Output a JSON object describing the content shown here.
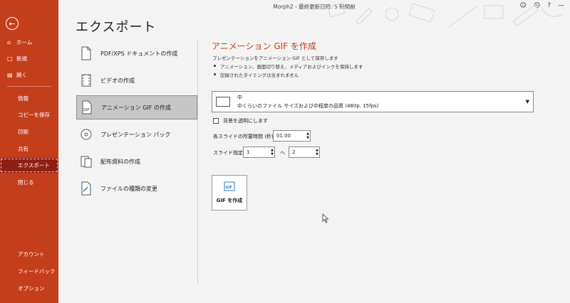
{
  "titlebar": {
    "title": "Morph2 - 最終更新日時: 5 時間前",
    "icons": [
      "smiley-icon",
      "sad-icon",
      "help-icon",
      "minimize-icon"
    ]
  },
  "rail": {
    "back_icon": "back-arrow-icon",
    "items": [
      {
        "label": "ホーム",
        "icon": "home-icon"
      },
      {
        "label": "新規",
        "icon": "new-file-icon"
      },
      {
        "label": "開く",
        "icon": "folder-icon"
      },
      {
        "label": "情報"
      },
      {
        "label": "コピーを保存"
      },
      {
        "label": "印刷"
      },
      {
        "label": "共有"
      },
      {
        "label": "エクスポート",
        "selected": true
      },
      {
        "label": "閉じる"
      },
      {
        "label": "アカウント"
      },
      {
        "label": "フィードバック"
      },
      {
        "label": "オプション"
      }
    ]
  },
  "page": {
    "heading": "エクスポート"
  },
  "export_options": [
    {
      "label": "PDF/XPS ドキュメントの作成",
      "icon": "pdf-document-icon"
    },
    {
      "label": "ビデオの作成",
      "icon": "video-icon"
    },
    {
      "label": "アニメーション GIF の作成",
      "icon": "gif-icon",
      "selected": true
    },
    {
      "label": "プレゼンテーション パック",
      "icon": "disc-icon"
    },
    {
      "label": "配布資料の作成",
      "icon": "handout-icon"
    },
    {
      "label": "ファイルの種類の変更",
      "icon": "change-file-type-icon"
    }
  ],
  "gif_panel": {
    "title": "アニメーション GIF を作成",
    "description": "プレゼンテーションをアニメーション GIF として保存します",
    "bullets": [
      "アニメーション、画面切り替え、メディアおよびインクを保持します",
      "記録されたタイミングは含まれません"
    ],
    "quality": {
      "name": "中",
      "detail": "中くらいのファイル サイズおよび中程度の品質 (480p, 15fps)",
      "icon": "monitor-icon"
    },
    "transparent_bg_label": "背景を透明にします",
    "seconds_label": "各スライドの所要時間 (秒):",
    "seconds_value": "01.00",
    "slides_label": "スライド指定:",
    "slide_from": "1",
    "range_separator": "へ",
    "slide_to": "2",
    "create_button": "GIF を作成",
    "create_icon": "gif-file-icon"
  }
}
